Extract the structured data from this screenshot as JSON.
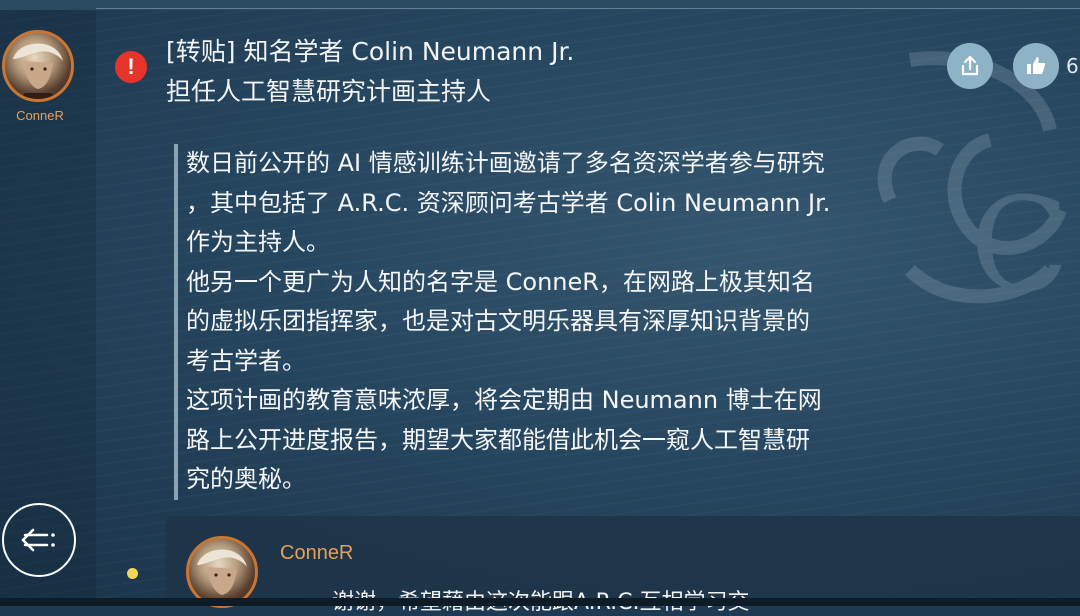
{
  "sidebar": {
    "username": "ConneR"
  },
  "post": {
    "title_line1": "[转贴] 知名学者 Colin Neumann Jr.",
    "title_line2": "担任人工智慧研究计画主持人",
    "like_count": "6",
    "body": [
      "数日前公开的 AI 情感训练计画邀请了多名资深学者参与研究",
      "，其中包括了 A.R.C. 资深顾问考古学者 Colin Neumann Jr.",
      "作为主持人。",
      "他另一个更广为人知的名字是 ConneR，在网路上极其知名",
      "的虚拟乐团指挥家，也是对古文明乐器具有深厚知识背景的",
      "考古学者。",
      "这项计画的教育意味浓厚，将会定期由 Neumann 博士在网",
      "路上公开进度报告，期望大家都能借此机会一窥人工智慧研",
      "究的奥秘。"
    ]
  },
  "comment": {
    "username": "ConneR",
    "text": "谢谢，希望藉由这次能跟A.R.C.互相学习交"
  },
  "colors": {
    "accent": "#e2a05a",
    "alert": "#e5342a",
    "button_bg": "#8fb3c6",
    "background": "#1e3a52"
  },
  "icons": {
    "alert": "alert-icon",
    "share": "share-icon",
    "like": "thumbs-up-icon",
    "back": "back-icon"
  }
}
